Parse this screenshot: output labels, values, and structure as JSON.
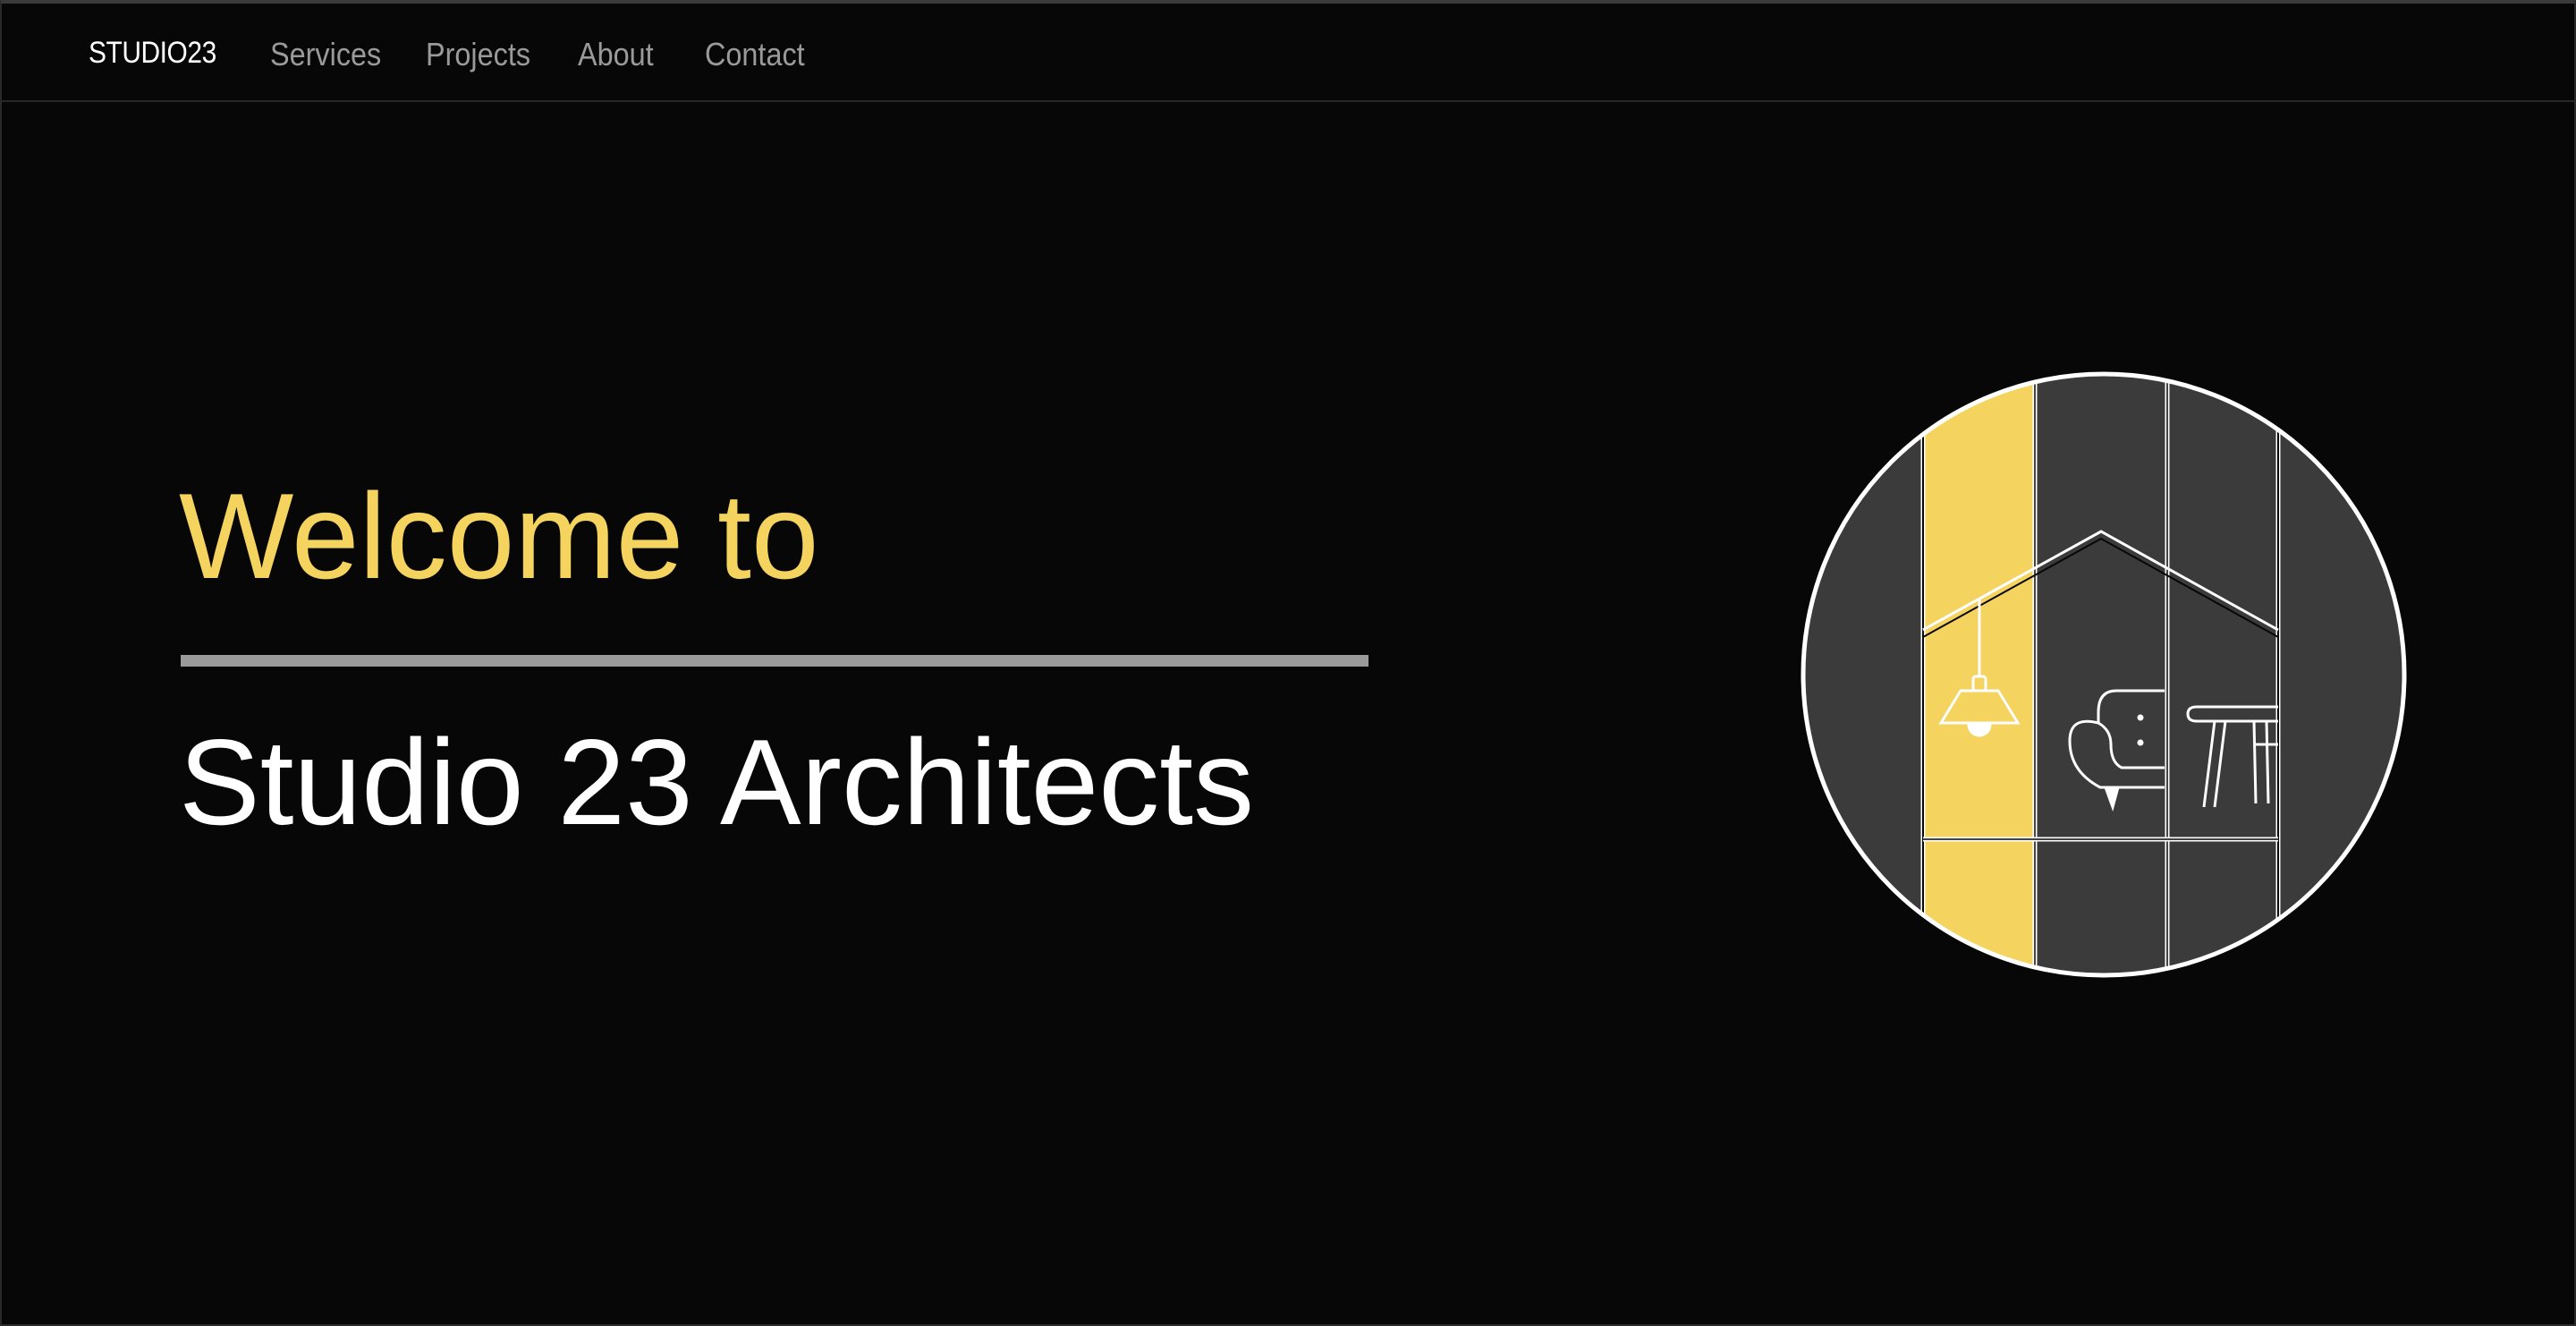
{
  "nav": {
    "brand": "STUDIO23",
    "links": [
      {
        "label": "Services"
      },
      {
        "label": "Projects"
      },
      {
        "label": "About"
      },
      {
        "label": "Contact"
      }
    ]
  },
  "hero": {
    "welcome": "Welcome to",
    "title": "Studio 23 Architects"
  },
  "colors": {
    "background": "#070707",
    "accent_yellow": "#f4d35e",
    "panel_gray": "#3b3b3b",
    "divider_gray": "#9a9a9a",
    "nav_link_gray": "#9a9a9a",
    "line_white": "#ffffff"
  },
  "illustration": {
    "icons": [
      "pendant-lamp-icon",
      "armchair-icon",
      "side-table-icon",
      "house-roof-icon"
    ]
  }
}
